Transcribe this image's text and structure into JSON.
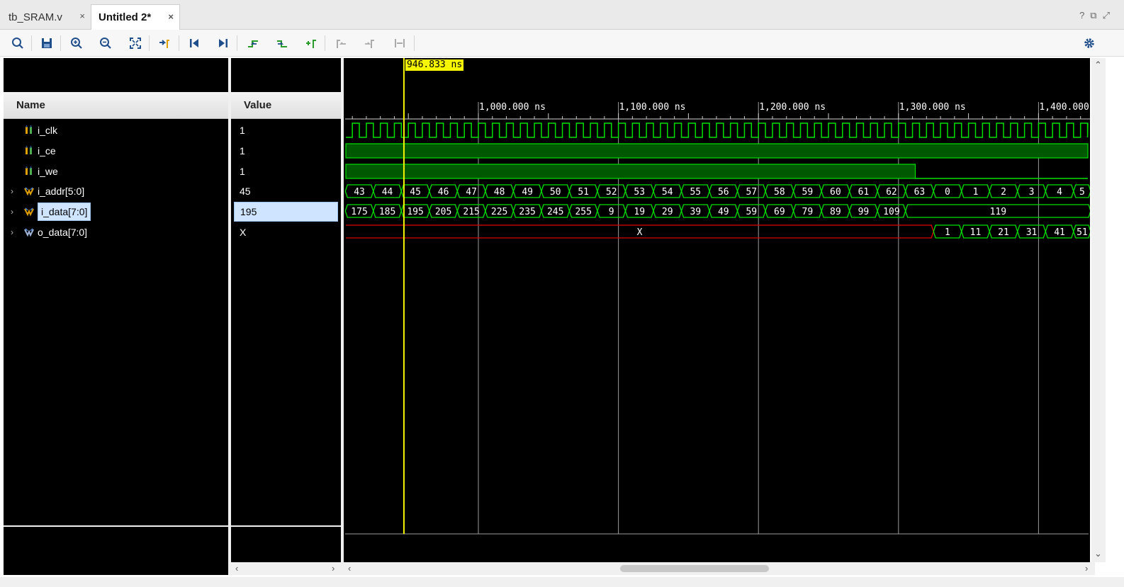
{
  "tabs": [
    {
      "label": "tb_SRAM.v",
      "close": "×"
    },
    {
      "label": "Untitled 2*",
      "close": "×"
    }
  ],
  "window_controls": [
    "?",
    "⧉",
    "⤢"
  ],
  "toolbar": {
    "icons": [
      "search-icon",
      "save-icon",
      "zoom-in-icon",
      "zoom-out-icon",
      "zoom-fit-icon",
      "go-to-cursor-icon",
      "go-to-time-0-icon",
      "go-to-last-time-icon",
      "previous-transition-icon",
      "next-transition-icon",
      "add-marker-icon",
      "previous-marker-icon",
      "next-marker-icon",
      "swap-cursors-icon",
      "settings-icon"
    ]
  },
  "columns": {
    "name": "Name",
    "value": "Value"
  },
  "cursor": {
    "label": "946.833 ns",
    "time_ns": 946.833
  },
  "time_axis": {
    "labels": [
      "1,000.000 ns",
      "1,100.000 ns",
      "1,200.000 ns",
      "1,300.000 ns",
      "1,400.000"
    ],
    "major_ns": [
      1000,
      1100,
      1200,
      1300,
      1400
    ]
  },
  "signals": [
    {
      "name": "i_clk",
      "value": "1",
      "expandable": false,
      "kind": "bit",
      "selected": false
    },
    {
      "name": "i_ce",
      "value": "1",
      "expandable": false,
      "kind": "bit",
      "selected": false
    },
    {
      "name": "i_we",
      "value": "1",
      "expandable": false,
      "kind": "bit",
      "selected": false
    },
    {
      "name": "i_addr[5:0]",
      "value": "45",
      "expandable": true,
      "kind": "bus",
      "selected": false
    },
    {
      "name": "i_data[7:0]",
      "value": "195",
      "expandable": true,
      "kind": "bus",
      "selected": true
    },
    {
      "name": "o_data[7:0]",
      "value": "X",
      "expandable": true,
      "kind": "bus",
      "selected": false
    }
  ],
  "waveforms": {
    "clk_period_ns": 10,
    "i_we_falls_at_ns": 1312,
    "i_addr": [
      "43",
      "44",
      "45",
      "46",
      "47",
      "48",
      "49",
      "50",
      "51",
      "52",
      "53",
      "54",
      "55",
      "56",
      "57",
      "58",
      "59",
      "60",
      "61",
      "62",
      "63",
      "0",
      "1",
      "2",
      "3",
      "4",
      "5"
    ],
    "i_data": [
      "175",
      "185",
      "195",
      "205",
      "215",
      "225",
      "235",
      "245",
      "255",
      "9",
      "19",
      "29",
      "39",
      "49",
      "59",
      "69",
      "79",
      "89",
      "99",
      "109",
      "119"
    ],
    "o_data_x_label": "X",
    "o_data": [
      "1",
      "11",
      "21",
      "31",
      "41",
      "51"
    ]
  }
}
